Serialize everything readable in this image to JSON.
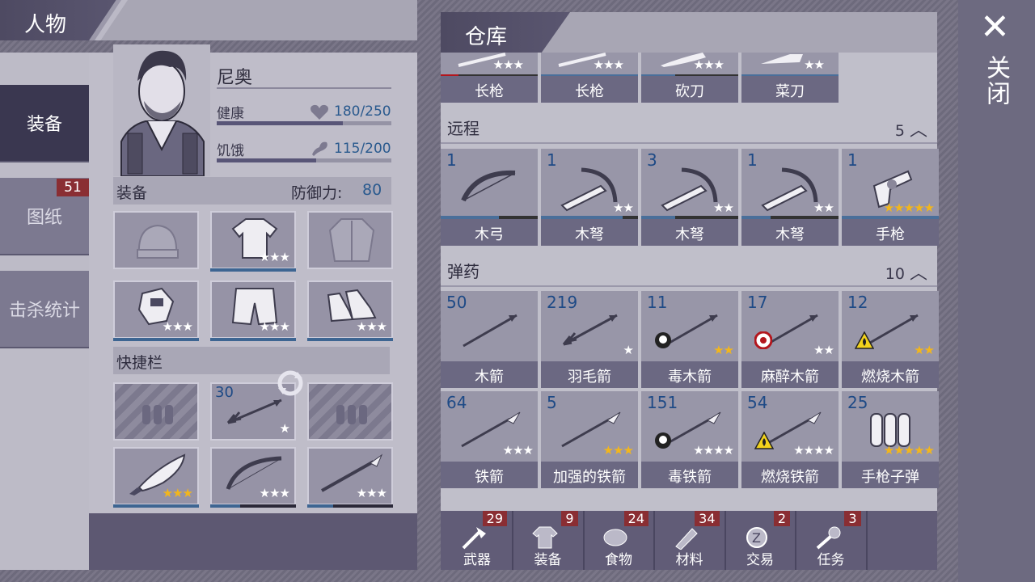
{
  "close_label": "关闭",
  "left": {
    "title": "人物",
    "tabs": [
      {
        "label": "装备"
      },
      {
        "label": "图纸",
        "badge": "51"
      },
      {
        "label": "击杀统计"
      }
    ],
    "character": {
      "name": "尼奥",
      "health_label": "健康",
      "health_value": "180/250",
      "hunger_label": "饥饿",
      "hunger_value": "115/200"
    },
    "equipment": {
      "label": "装备",
      "defense_label": "防御力:",
      "defense_value": "80"
    },
    "gear": [
      {
        "slot": "head",
        "stars": ""
      },
      {
        "slot": "body",
        "stars": "★★★"
      },
      {
        "slot": "outer",
        "stars": ""
      },
      {
        "slot": "hands",
        "stars": "★★★"
      },
      {
        "slot": "legs",
        "stars": "★★★"
      },
      {
        "slot": "feet",
        "stars": "★★★"
      }
    ],
    "quickbar": {
      "label": "快捷栏",
      "slots": [
        {
          "item": "empty"
        },
        {
          "item": "arrow",
          "count": "30",
          "stars": "★"
        },
        {
          "item": "empty"
        },
        {
          "item": "machete",
          "stars": "★★★"
        },
        {
          "item": "bow",
          "stars": "★★★"
        },
        {
          "item": "spear",
          "stars": "★★★"
        }
      ]
    }
  },
  "right": {
    "title": "仓库",
    "melee": [
      {
        "name": "长枪",
        "stars": "★★★"
      },
      {
        "name": "长枪",
        "stars": "★★★"
      },
      {
        "name": "砍刀",
        "stars": "★★★"
      },
      {
        "name": "菜刀",
        "stars": "★★"
      }
    ],
    "ranged": {
      "label": "远程",
      "count": "5",
      "items": [
        {
          "count": "1",
          "name": "木弓",
          "stars": "",
          "gold": false,
          "icon": "bow",
          "durability": 0.6
        },
        {
          "count": "1",
          "name": "木弩",
          "stars": "★★",
          "gold": false,
          "icon": "crossbow",
          "durability": 0.84
        },
        {
          "count": "3",
          "name": "木弩",
          "stars": "★★",
          "gold": false,
          "icon": "crossbow",
          "durability": 0.35
        },
        {
          "count": "1",
          "name": "木弩",
          "stars": "★★",
          "gold": false,
          "icon": "crossbow",
          "durability": 0.3
        },
        {
          "count": "1",
          "name": "手枪",
          "stars": "★★★★★",
          "gold": true,
          "icon": "pistol",
          "durability": 1.0
        }
      ]
    },
    "ammo": {
      "label": "弹药",
      "count": "10",
      "items": [
        {
          "count": "50",
          "name": "木箭",
          "stars": "",
          "gold": false,
          "icon": "arrow",
          "tag": ""
        },
        {
          "count": "219",
          "name": "羽毛箭",
          "stars": "★",
          "gold": false,
          "icon": "feather-arrow",
          "tag": ""
        },
        {
          "count": "11",
          "name": "毒木箭",
          "stars": "★★",
          "gold": true,
          "icon": "arrow",
          "tag": "poison"
        },
        {
          "count": "17",
          "name": "麻醉木箭",
          "stars": "★★",
          "gold": false,
          "icon": "arrow",
          "tag": "sleep"
        },
        {
          "count": "12",
          "name": "燃烧木箭",
          "stars": "★★",
          "gold": true,
          "icon": "arrow",
          "tag": "fire"
        },
        {
          "count": "64",
          "name": "铁箭",
          "stars": "★★★",
          "gold": false,
          "icon": "iron-arrow",
          "tag": ""
        },
        {
          "count": "5",
          "name": "加强的铁箭",
          "stars": "★★★",
          "gold": true,
          "icon": "iron-arrow",
          "tag": ""
        },
        {
          "count": "151",
          "name": "毒铁箭",
          "stars": "★★★★",
          "gold": false,
          "icon": "iron-arrow",
          "tag": "poison"
        },
        {
          "count": "54",
          "name": "燃烧铁箭",
          "stars": "★★★★",
          "gold": false,
          "icon": "iron-arrow",
          "tag": "fire"
        },
        {
          "count": "25",
          "name": "手枪子弹",
          "stars": "★★★★★",
          "gold": true,
          "icon": "bullets",
          "tag": ""
        }
      ]
    },
    "categories": [
      {
        "label": "武器",
        "badge": "29",
        "icon": "axe"
      },
      {
        "label": "装备",
        "badge": "9",
        "icon": "shirt"
      },
      {
        "label": "食物",
        "badge": "24",
        "icon": "meat"
      },
      {
        "label": "材料",
        "badge": "34",
        "icon": "log"
      },
      {
        "label": "交易",
        "badge": "2",
        "icon": "coin"
      },
      {
        "label": "任务",
        "badge": "3",
        "icon": "key"
      }
    ]
  }
}
